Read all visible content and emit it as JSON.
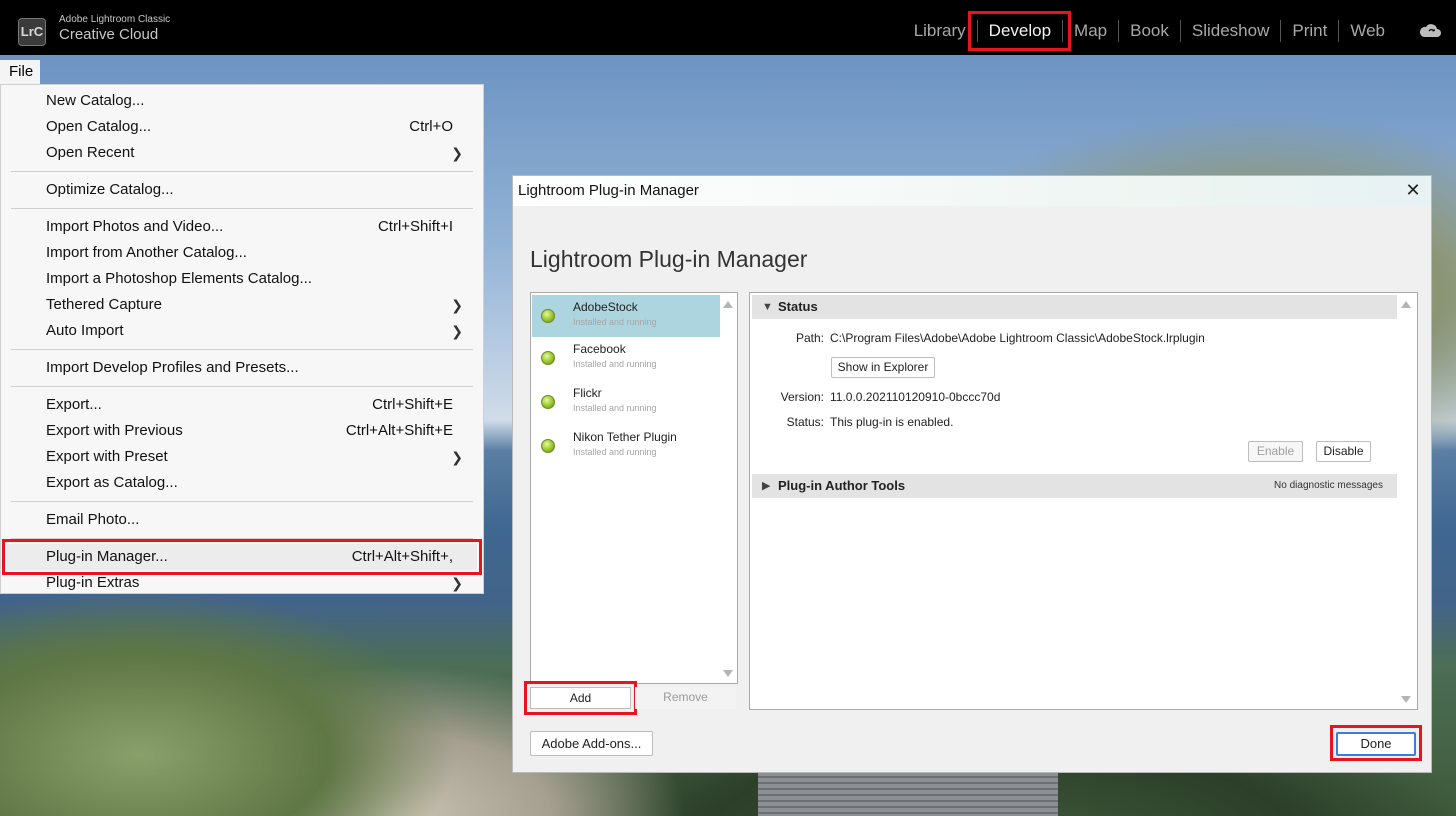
{
  "topbar": {
    "app_name_small": "Adobe Lightroom Classic",
    "app_name_large": "Creative Cloud",
    "logo_text": "LrC",
    "modules": [
      "Library",
      "Develop",
      "Map",
      "Book",
      "Slideshow",
      "Print",
      "Web"
    ],
    "active_module": "Develop",
    "cloud_icon": "cloud-sync-icon"
  },
  "file_menu": {
    "label": "File",
    "items": {
      "new_catalog": "New Catalog...",
      "open_catalog": "Open Catalog...",
      "open_catalog_sc": "Ctrl+O",
      "open_recent": "Open Recent",
      "optimize_catalog": "Optimize Catalog...",
      "import_photos": "Import Photos and Video...",
      "import_photos_sc": "Ctrl+Shift+I",
      "import_catalog": "Import from Another Catalog...",
      "import_pse": "Import a Photoshop Elements Catalog...",
      "tethered": "Tethered Capture",
      "auto_import": "Auto Import",
      "import_profiles": "Import Develop Profiles and Presets...",
      "export": "Export...",
      "export_sc": "Ctrl+Shift+E",
      "export_previous": "Export with Previous",
      "export_previous_sc": "Ctrl+Alt+Shift+E",
      "export_preset": "Export with Preset",
      "export_catalog": "Export as Catalog...",
      "email_photo": "Email Photo...",
      "plugin_manager": "Plug-in Manager...",
      "plugin_manager_sc": "Ctrl+Alt+Shift+,",
      "plugin_extras": "Plug-in Extras"
    }
  },
  "dialog": {
    "window_title": "Lightroom Plug-in Manager",
    "heading": "Lightroom Plug-in Manager",
    "plugins": [
      {
        "name": "AdobeStock",
        "status": "Installed and running"
      },
      {
        "name": "Facebook",
        "status": "Installed and running"
      },
      {
        "name": "Flickr",
        "status": "Installed and running"
      },
      {
        "name": "Nikon Tether Plugin",
        "status": "Installed and running"
      }
    ],
    "add_label": "Add",
    "remove_label": "Remove",
    "status_section": "Status",
    "path_label": "Path:",
    "path_value": "C:\\Program Files\\Adobe\\Adobe Lightroom Classic\\AdobeStock.lrplugin",
    "show_in_explorer": "Show in Explorer",
    "version_label": "Version:",
    "version_value": "11.0.0.202110120910-0bccc70d",
    "status_label": "Status:",
    "status_value": "This plug-in is enabled.",
    "enable_label": "Enable",
    "disable_label": "Disable",
    "author_tools_section": "Plug-in Author Tools",
    "diagnostic_note": "No diagnostic messages",
    "addons_label": "Adobe Add-ons...",
    "done_label": "Done"
  },
  "highlight_color": "#e8141d"
}
